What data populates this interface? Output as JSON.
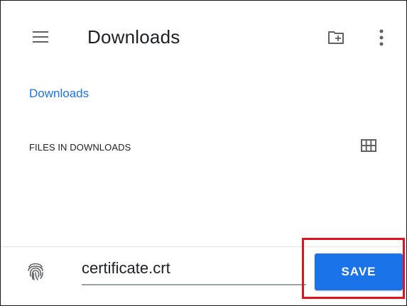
{
  "appbar": {
    "title": "Downloads",
    "icons": {
      "menu": "hamburger-menu-icon",
      "new_folder": "create-new-folder-icon",
      "overflow": "more-vert-icon"
    }
  },
  "breadcrumb": {
    "label": "Downloads"
  },
  "files_section": {
    "header": "FILES IN DOWNLOADS",
    "view_toggle_icon": "grid-view-icon"
  },
  "save_bar": {
    "icon": "fingerprint-icon",
    "filename": "certificate.crt",
    "save_label": "SAVE"
  },
  "colors": {
    "accent": "#1a73e8",
    "text": "#202124",
    "icon": "#5f6368",
    "highlight": "#e2131f"
  }
}
